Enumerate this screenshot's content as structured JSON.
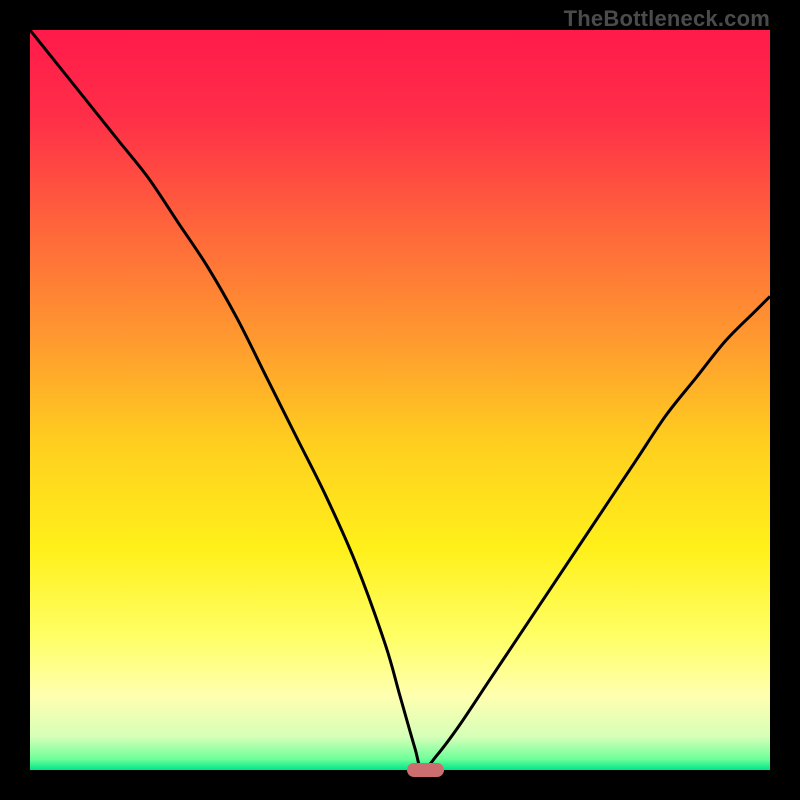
{
  "watermark": "TheBottleneck.com",
  "colors": {
    "frame": "#000000",
    "curve": "#000000",
    "marker": "#cc6e70",
    "gradient_stops": [
      {
        "offset": 0.0,
        "color": "#ff1a4a"
      },
      {
        "offset": 0.12,
        "color": "#ff2f48"
      },
      {
        "offset": 0.28,
        "color": "#ff6a3a"
      },
      {
        "offset": 0.42,
        "color": "#ff9a2f"
      },
      {
        "offset": 0.56,
        "color": "#ffcf1f"
      },
      {
        "offset": 0.7,
        "color": "#fff01a"
      },
      {
        "offset": 0.82,
        "color": "#ffff66"
      },
      {
        "offset": 0.9,
        "color": "#ffffb0"
      },
      {
        "offset": 0.955,
        "color": "#d6ffb8"
      },
      {
        "offset": 0.985,
        "color": "#6fff9a"
      },
      {
        "offset": 1.0,
        "color": "#00e58a"
      }
    ]
  },
  "chart_data": {
    "type": "line",
    "title": "",
    "xlabel": "",
    "ylabel": "",
    "xlim": [
      0,
      100
    ],
    "ylim": [
      0,
      100
    ],
    "optimum_x": 53,
    "marker": {
      "x_start": 51,
      "x_end": 56,
      "y": 0
    },
    "series": [
      {
        "name": "bottleneck-curve",
        "x": [
          0,
          4,
          8,
          12,
          16,
          20,
          24,
          28,
          32,
          36,
          40,
          44,
          48,
          50,
          52,
          53,
          55,
          58,
          62,
          66,
          70,
          74,
          78,
          82,
          86,
          90,
          94,
          98,
          100
        ],
        "y": [
          100,
          95,
          90,
          85,
          80,
          74,
          68,
          61,
          53,
          45,
          37,
          28,
          17,
          10,
          3,
          0,
          2,
          6,
          12,
          18,
          24,
          30,
          36,
          42,
          48,
          53,
          58,
          62,
          64
        ]
      }
    ]
  }
}
